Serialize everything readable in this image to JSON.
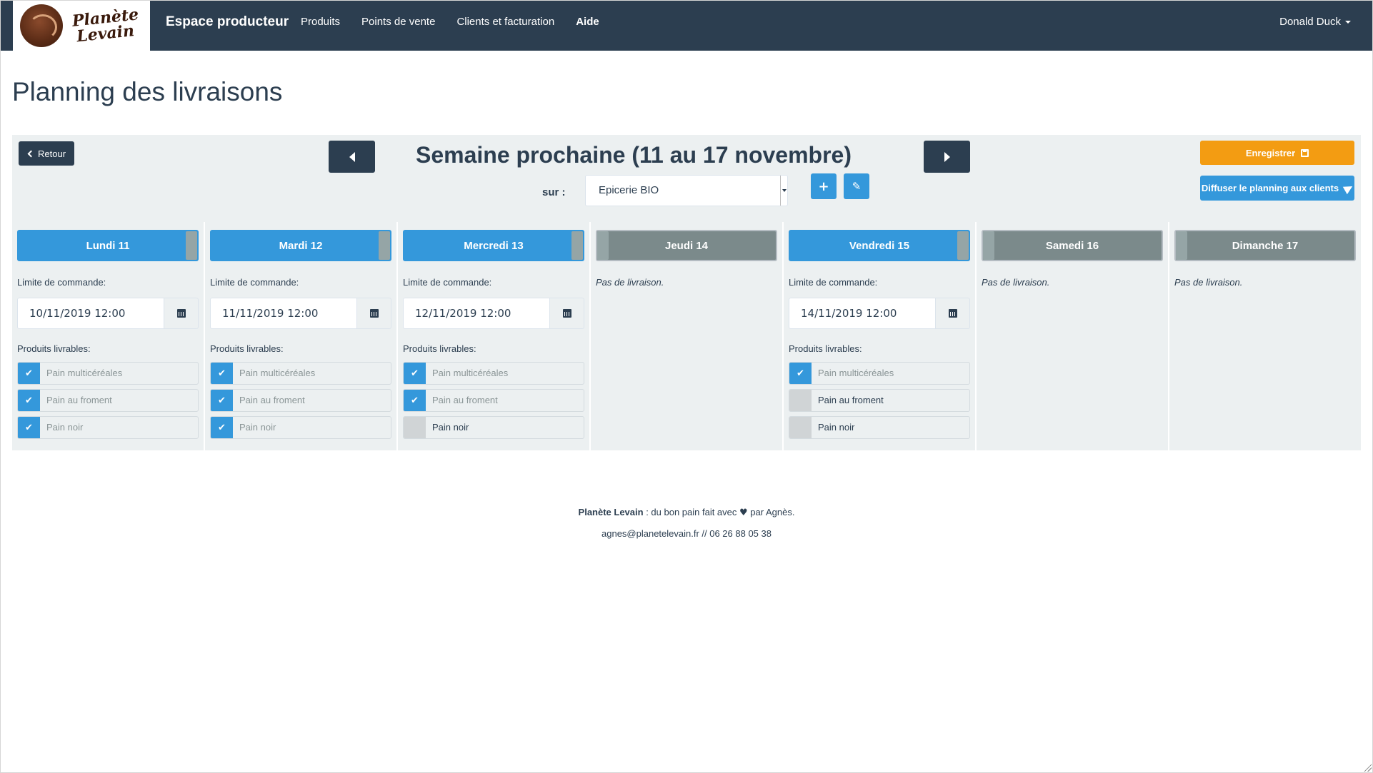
{
  "navbar": {
    "logo_text_line1": "Planète",
    "logo_text_line2": "Levain",
    "brand": "Espace producteur",
    "links": [
      "Produits",
      "Points de vente",
      "Clients et facturation",
      "Aide"
    ],
    "user": "Donald Duck"
  },
  "page": {
    "title": "Planning des livraisons"
  },
  "toolbar": {
    "back_label": "Retour",
    "week_title": "Semaine prochaine (11 au 17 novembre)",
    "sur_label": "sur :",
    "store_selected": "Epicerie BIO",
    "add_symbol": "+",
    "edit_symbol": "✎",
    "save_label": "Enregistrer",
    "diffuse_label": "Diffuser le planning aux clients"
  },
  "labels": {
    "limit": "Limite de commande:",
    "products": "Produits livrables:",
    "no_delivery": "Pas de livraison."
  },
  "days": [
    {
      "name": "Lundi 11",
      "active": true,
      "limit": "10/11/2019 12:00",
      "products": [
        {
          "name": "Pain multicéréales",
          "checked": true
        },
        {
          "name": "Pain au froment",
          "checked": true
        },
        {
          "name": "Pain noir",
          "checked": true
        }
      ]
    },
    {
      "name": "Mardi 12",
      "active": true,
      "limit": "11/11/2019 12:00",
      "products": [
        {
          "name": "Pain multicéréales",
          "checked": true
        },
        {
          "name": "Pain au froment",
          "checked": true
        },
        {
          "name": "Pain noir",
          "checked": true
        }
      ]
    },
    {
      "name": "Mercredi 13",
      "active": true,
      "limit": "12/11/2019 12:00",
      "products": [
        {
          "name": "Pain multicéréales",
          "checked": true
        },
        {
          "name": "Pain au froment",
          "checked": true
        },
        {
          "name": "Pain noir",
          "checked": false
        }
      ]
    },
    {
      "name": "Jeudi 14",
      "active": false
    },
    {
      "name": "Vendredi 15",
      "active": true,
      "limit": "14/11/2019 12:00",
      "products": [
        {
          "name": "Pain multicéréales",
          "checked": true
        },
        {
          "name": "Pain au froment",
          "checked": false
        },
        {
          "name": "Pain noir",
          "checked": false
        }
      ]
    },
    {
      "name": "Samedi 16",
      "active": false
    },
    {
      "name": "Dimanche 17",
      "active": false
    }
  ],
  "footer": {
    "brand": "Planète Levain",
    "text_before_heart": " : du bon pain fait avec ",
    "heart": "♥",
    "text_after_heart": " par Agnès.",
    "contact": "agnes@planetelevain.fr // 06 26 88 05 38"
  },
  "colors": {
    "navbar": "#2c3e50",
    "primary": "#3498db",
    "warning": "#f39c12",
    "panel": "#ecf0f1",
    "inactive_day": "#7b8a8b"
  }
}
